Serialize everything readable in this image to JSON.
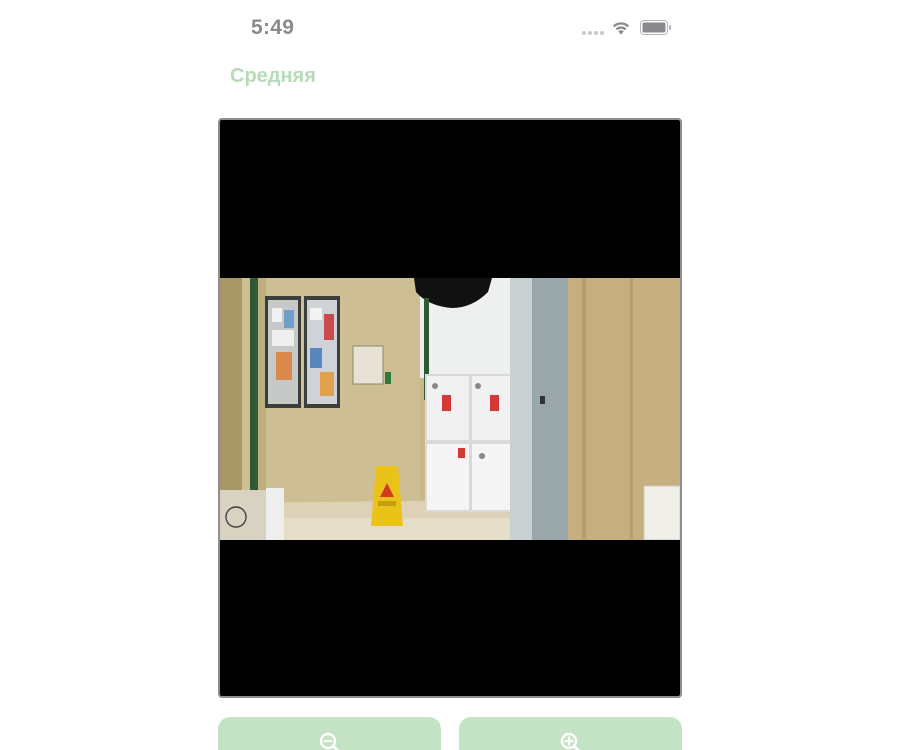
{
  "status_bar": {
    "time": "5:49",
    "signal_icon": "signal-dots-icon",
    "wifi_icon": "wifi-icon",
    "battery_icon": "battery-icon"
  },
  "header": {
    "title": "Средняя",
    "title_color": "#b6dbb7"
  },
  "camera": {
    "feed_description_icon": "camera-feed-image",
    "frame_border_color": "#8e8e93"
  },
  "controls": {
    "zoom_out_icon": "zoom-out-icon",
    "zoom_in_icon": "zoom-in-icon",
    "button_color": "#c4e3c5"
  }
}
